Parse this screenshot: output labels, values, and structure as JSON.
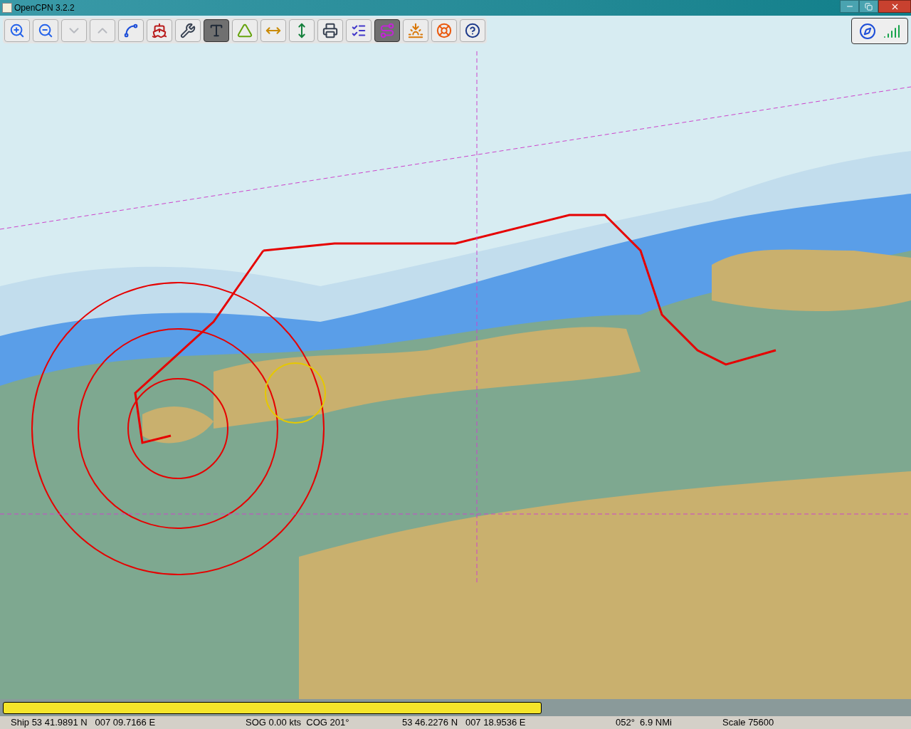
{
  "window": {
    "title": "OpenCPN 3.2.2"
  },
  "toolbar": [
    {
      "selected": false,
      "disabled": false
    },
    {
      "selected": false,
      "disabled": false
    },
    {
      "selected": false,
      "disabled": true
    },
    {
      "selected": false,
      "disabled": true
    },
    {
      "selected": false,
      "disabled": false
    },
    {
      "selected": false,
      "disabled": false
    },
    {
      "selected": false,
      "disabled": false
    },
    {
      "selected": true,
      "disabled": false
    },
    {
      "selected": false,
      "disabled": false
    },
    {
      "selected": false,
      "disabled": false
    },
    {
      "selected": false,
      "disabled": false
    },
    {
      "selected": false,
      "disabled": false
    },
    {
      "selected": false,
      "disabled": false
    },
    {
      "selected": true,
      "disabled": false
    },
    {
      "selected": false,
      "disabled": false
    },
    {
      "selected": false,
      "disabled": false
    },
    {
      "selected": false,
      "disabled": false
    }
  ],
  "progress": {
    "level": 0.595
  },
  "status_bar": [
    "Ship 53 41.9891 N   007 09.7166 E",
    "SOG 0.00 kts  COG 201°",
    "53 46.2276 N   007 18.9536 E",
    "052°  6.9 NMi",
    "Scale 75600"
  ]
}
